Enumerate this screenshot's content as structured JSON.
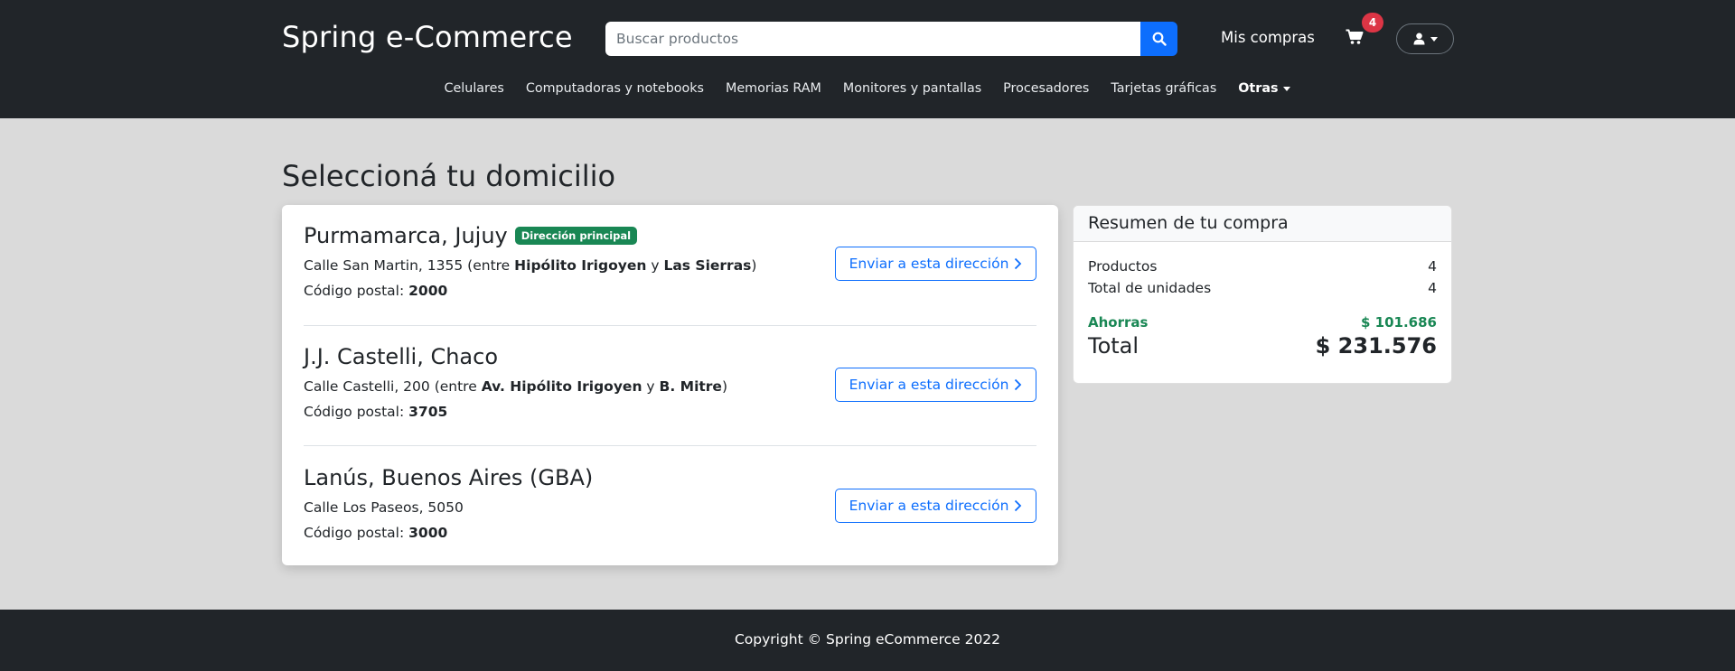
{
  "header": {
    "brand": "Spring e-Commerce",
    "search": {
      "placeholder": "Buscar productos",
      "icon": "search-icon"
    },
    "my_purchases": "Mis compras",
    "cart": {
      "icon": "cart-icon",
      "count": "4"
    },
    "user_menu": {
      "icon": "user-icon"
    }
  },
  "categories": {
    "items": [
      "Celulares",
      "Computadoras y notebooks",
      "Memorias RAM",
      "Monitores y pantallas",
      "Procesadores",
      "Tarjetas gráficas"
    ],
    "more_label": "Otras"
  },
  "main": {
    "title": "Seleccioná tu domicilio",
    "primary_badge": "Dirección principal",
    "send_button_label": "Enviar a esta dirección",
    "postal_prefix": "Código postal:",
    "addresses": [
      {
        "city": "Purmamarca, Jujuy",
        "street_prefix": "Calle San Martin, 1355 (entre",
        "between_a": "Hipólito Irigoyen",
        "and_word": "y",
        "between_b": "Las Sierras",
        "street_suffix": ")",
        "postal_code": "2000"
      },
      {
        "city": "J.J. Castelli, Chaco",
        "street_prefix": "Calle Castelli, 200 (entre",
        "between_a": "Av. Hipólito Irigoyen",
        "and_word": "y",
        "between_b": "B. Mitre",
        "street_suffix": ")",
        "postal_code": "3705"
      },
      {
        "city": "Lanús, Buenos Aires (GBA)",
        "street": "Calle Los Paseos, 5050",
        "postal_code": "3000"
      }
    ]
  },
  "summary": {
    "title": "Resumen de tu compra",
    "products_label": "Productos",
    "products_value": "4",
    "units_label": "Total de unidades",
    "units_value": "4",
    "savings_label": "Ahorras",
    "savings_value": "$ 101.686",
    "total_label": "Total",
    "total_value": "$ 231.576"
  },
  "footer": {
    "text": "Copyright © Spring eCommerce 2022"
  },
  "colors": {
    "navbar": "#212529",
    "page_bg": "#dadada",
    "primary": "#0d6efd",
    "success": "#198754",
    "danger": "#dc3545"
  }
}
